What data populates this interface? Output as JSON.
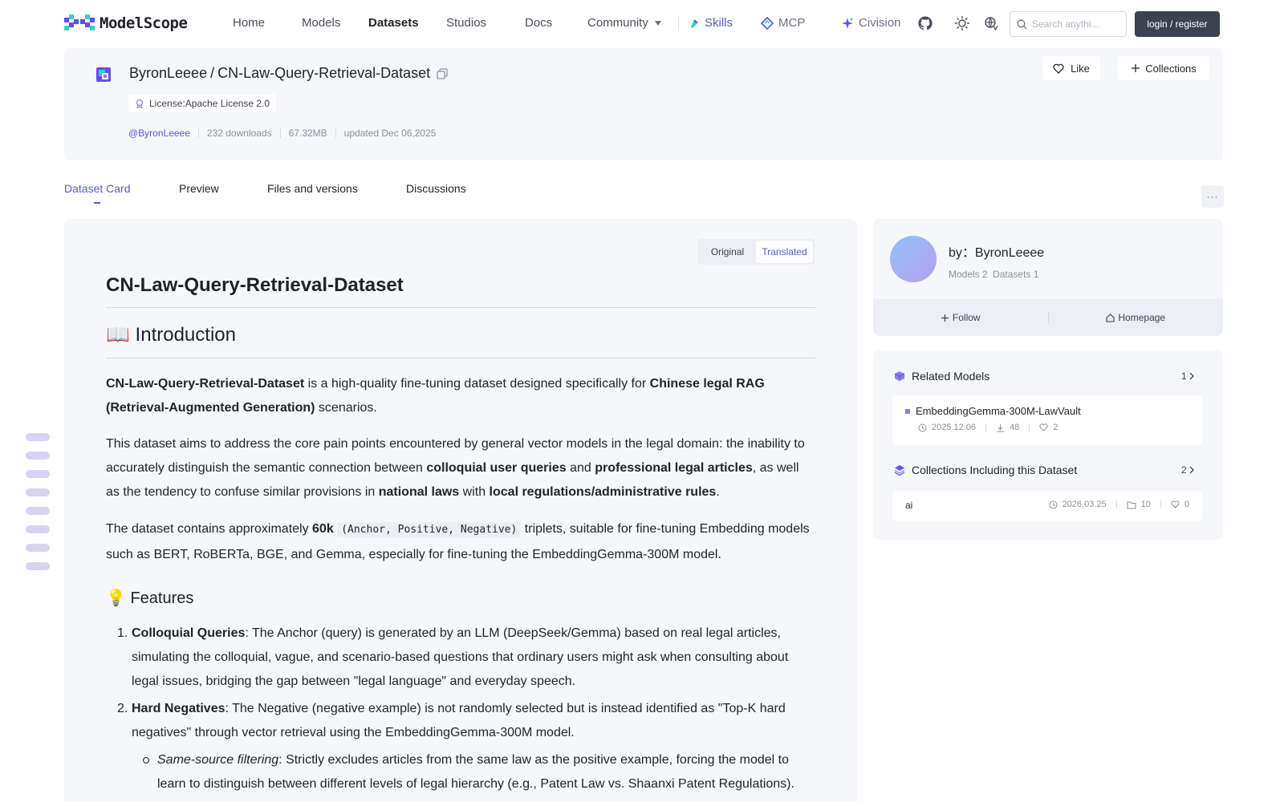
{
  "nav": {
    "logo_text": "ModelScope",
    "items": [
      "Home",
      "Models",
      "Datasets",
      "Studios",
      "Docs",
      "Community"
    ],
    "active": "Datasets",
    "skills": "Skills",
    "mcp": "MCP",
    "civision": "Civision",
    "search_placeholder": "Search anythi...",
    "login": "login / register",
    "accent_color": "#5b57d6"
  },
  "repo": {
    "owner": "ByronLeeee",
    "slash": "/",
    "name": "CN-Law-Query-Retrieval-Dataset",
    "license": "License:Apache License 2.0",
    "author_handle": "@ByronLeeee",
    "downloads": "232 downloads",
    "size": "67.32MB",
    "updated": "updated Dec 06,2025",
    "like_label": "Like",
    "collections_label": "Collections"
  },
  "tabs": [
    "Dataset Card",
    "Preview",
    "Files and versions",
    "Discussions"
  ],
  "active_tab": "Dataset Card",
  "more_label": "···",
  "card": {
    "toggle_original": "Original",
    "toggle_translated": "Translated",
    "toggle_selected": "Translated",
    "title": "CN-Law-Query-Retrieval-Dataset",
    "intro_heading": "📖 Introduction",
    "p1": {
      "a": "CN-Law-Query-Retrieval-Dataset",
      "b": " is a high-quality fine-tuning dataset designed specifically for ",
      "c": "Chinese legal RAG (Retrieval-Augmented Generation)",
      "d": " scenarios."
    },
    "p2": {
      "a": "This dataset aims to address the core pain points encountered by general vector models in the legal domain: the inability to accurately distinguish the semantic connection between ",
      "b": "colloquial user queries",
      "c": " and ",
      "d": "professional legal articles",
      "e": ", as well as the tendency to confuse similar provisions in ",
      "f": "national laws",
      "g": " with ",
      "h": "local regulations/administrative rules",
      "i": "."
    },
    "p3": {
      "a": "The dataset contains approximately ",
      "b": "60k",
      "c": " ",
      "code": "(Anchor, Positive, Negative)",
      "d": " triplets, suitable for fine-tuning Embedding models such as BERT, RoBERTa, BGE, and Gemma, especially for fine-tuning the EmbeddingGemma-300M model."
    },
    "features_heading": "💡 Features",
    "features": [
      {
        "num": "1.",
        "title": "Colloquial Queries",
        "text": ": The Anchor (query) is generated by an LLM (DeepSeek/Gemma) based on real legal articles, simulating the colloquial, vague, and scenario-based questions that ordinary users might ask when consulting about legal issues, bridging the gap between \"legal language\" and everyday speech."
      },
      {
        "num": "2.",
        "title": "Hard Negatives",
        "text": ": The Negative (negative example) is not randomly selected but is instead identified as \"Top-K hard negatives\" through vector retrieval using the EmbeddingGemma-300M model."
      }
    ],
    "sub_feature": {
      "title": "Same-source filtering",
      "text": ": Strictly excludes articles from the same law as the positive example, forcing the model to learn to distinguish between different levels of legal hierarchy (e.g., Patent Law vs. Shaanxi Patent Regulations)."
    }
  },
  "author_card": {
    "by": "by：ByronLeeee",
    "models": "Models 2",
    "datasets": "Datasets 1",
    "follow": "Follow",
    "homepage": "Homepage"
  },
  "related_models": {
    "heading": "Related Models",
    "count": "1",
    "items": [
      {
        "name": "EmbeddingGemma-300M-LawVault",
        "date": "2025.12.06",
        "downloads": "48",
        "likes": "2"
      }
    ]
  },
  "collections": {
    "heading": "Collections Including this Dataset",
    "count": "2",
    "items": [
      {
        "name": "ai",
        "date": "2026.03.25",
        "items": "10",
        "likes": "0"
      }
    ]
  }
}
